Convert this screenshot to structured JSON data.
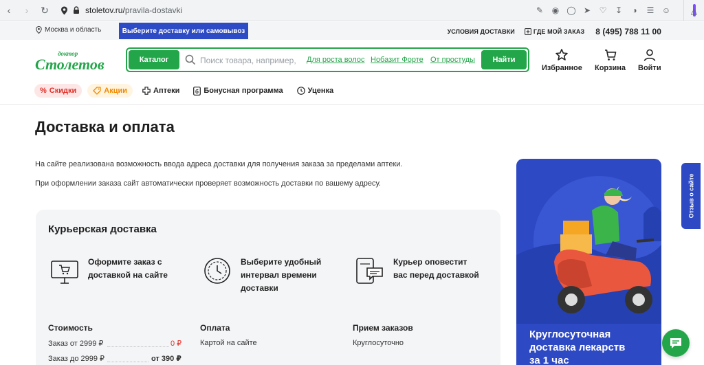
{
  "browser": {
    "url_domain": "stoletov.ru/",
    "url_path": "pravila-dostavki"
  },
  "topbar": {
    "region": "Москва и область",
    "choose_delivery": "Выберите доставку или самовывоз",
    "delivery_terms": "УСЛОВИЯ ДОСТАВКИ",
    "where_order": "ГДЕ МОЙ ЗАКАЗ",
    "phone": "8 (495) 788 11 00"
  },
  "search": {
    "catalog": "Каталог",
    "placeholder": "Поиск товара, например,",
    "hints": [
      "Для роста волос",
      "Нобазит Форте",
      "От простуды"
    ],
    "find": "Найти"
  },
  "header_actions": {
    "favorites": "Избранное",
    "cart": "Корзина",
    "login": "Войти"
  },
  "subnav": {
    "sale": "Скидки",
    "promo": "Акции",
    "pharmacies": "Аптеки",
    "bonus": "Бонусная программа",
    "markdown": "Уценка"
  },
  "page": {
    "title": "Доставка и оплата",
    "para1": "На сайте реализована возможность ввода адреса доставки для получения заказа за пределами аптеки.",
    "para2": "При оформлении заказа сайт автоматически проверяет возможность доставки по вашему адресу."
  },
  "courier": {
    "title": "Курьерская доставка",
    "steps": [
      {
        "line1": "Оформите заказ с",
        "line2": "доставкой на сайте",
        "line3": ""
      },
      {
        "line1": "Выберите удобный",
        "line2": "интервал времени",
        "line3": "доставки"
      },
      {
        "line1": "Курьер оповестит",
        "line2": "вас перед доставкой",
        "line3": ""
      }
    ],
    "cost_title": "Стоимость",
    "cost_rows": [
      {
        "label": "Заказ от 2999 ₽",
        "value": "0 ₽"
      },
      {
        "label": "Заказ до 2999 ₽",
        "value": "от 390 ₽"
      }
    ],
    "payment_title": "Оплата",
    "payment_value": "Картой на сайте",
    "orders_title": "Прием заказов",
    "orders_value": "Круглосуточно"
  },
  "banner": {
    "line1": "Круглосуточная",
    "line2": "доставка лекарств",
    "line3": "за 1 час"
  },
  "feedback": "Отзыв о сайте",
  "colors": {
    "brand_green": "#23a64a",
    "brand_blue": "#2e49c4",
    "sale_red": "#e0302a",
    "promo_orange": "#f08a00"
  }
}
